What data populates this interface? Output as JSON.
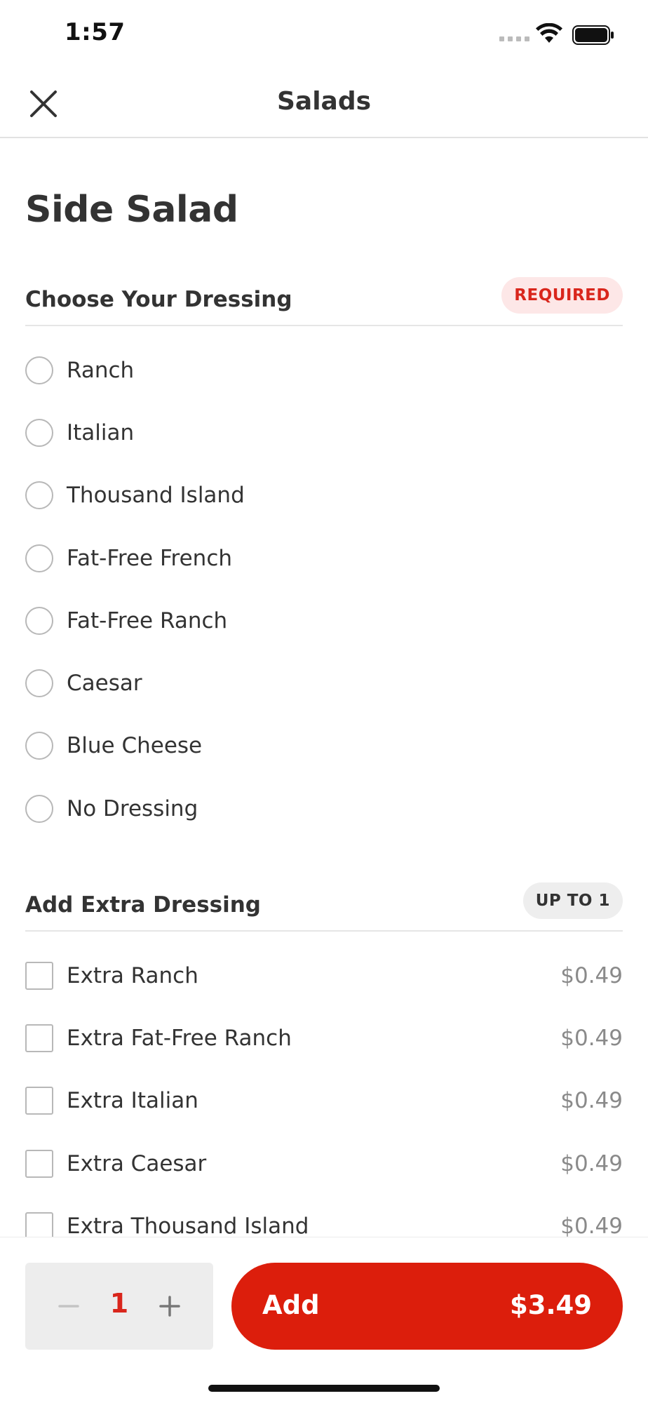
{
  "status_bar": {
    "time": "1:57"
  },
  "nav": {
    "title": "Salads",
    "close_icon": "close-icon"
  },
  "item": {
    "title": "Side Salad"
  },
  "dressing_section": {
    "title": "Choose Your Dressing",
    "badge": "REQUIRED",
    "options": [
      {
        "label": "Ranch"
      },
      {
        "label": "Italian"
      },
      {
        "label": "Thousand Island"
      },
      {
        "label": "Fat-Free French"
      },
      {
        "label": "Fat-Free Ranch"
      },
      {
        "label": "Caesar"
      },
      {
        "label": "Blue Cheese"
      },
      {
        "label": "No Dressing"
      }
    ]
  },
  "extra_section": {
    "title": "Add Extra Dressing",
    "badge": "UP TO 1",
    "options": [
      {
        "label": "Extra Ranch",
        "price": "$0.49"
      },
      {
        "label": "Extra Fat-Free Ranch",
        "price": "$0.49"
      },
      {
        "label": "Extra Italian",
        "price": "$0.49"
      },
      {
        "label": "Extra Caesar",
        "price": "$0.49"
      },
      {
        "label": "Extra Thousand Island",
        "price": "$0.49"
      }
    ]
  },
  "footer": {
    "quantity": "1",
    "add_label": "Add",
    "add_price": "$3.49"
  },
  "colors": {
    "accent": "#dc1e0c",
    "required_badge_bg": "#fde7e7",
    "text": "#333333",
    "price_text": "#8a8a8a"
  }
}
